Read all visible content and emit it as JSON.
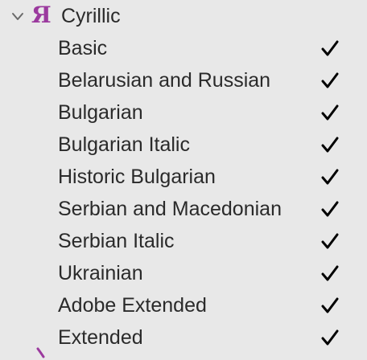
{
  "group": {
    "label": "Cyrillic",
    "glyph": "Я",
    "glyph_color": "#9b3a9e",
    "expanded": true,
    "icons": {
      "toggle": "chevron-down-icon",
      "status": "checkmark-icon"
    }
  },
  "items": [
    {
      "label": "Basic",
      "checked": true
    },
    {
      "label": "Belarusian and Russian",
      "checked": true
    },
    {
      "label": "Bulgarian",
      "checked": true
    },
    {
      "label": "Bulgarian Italic",
      "checked": true
    },
    {
      "label": "Historic Bulgarian",
      "checked": true
    },
    {
      "label": "Serbian and Macedonian",
      "checked": true
    },
    {
      "label": "Serbian Italic",
      "checked": true
    },
    {
      "label": "Ukrainian",
      "checked": true
    },
    {
      "label": "Adobe Extended",
      "checked": true
    },
    {
      "label": "Extended",
      "checked": true
    }
  ],
  "colors": {
    "background": "#e8e8e8",
    "text": "#2a2a2a",
    "accent": "#9b3a9e"
  }
}
